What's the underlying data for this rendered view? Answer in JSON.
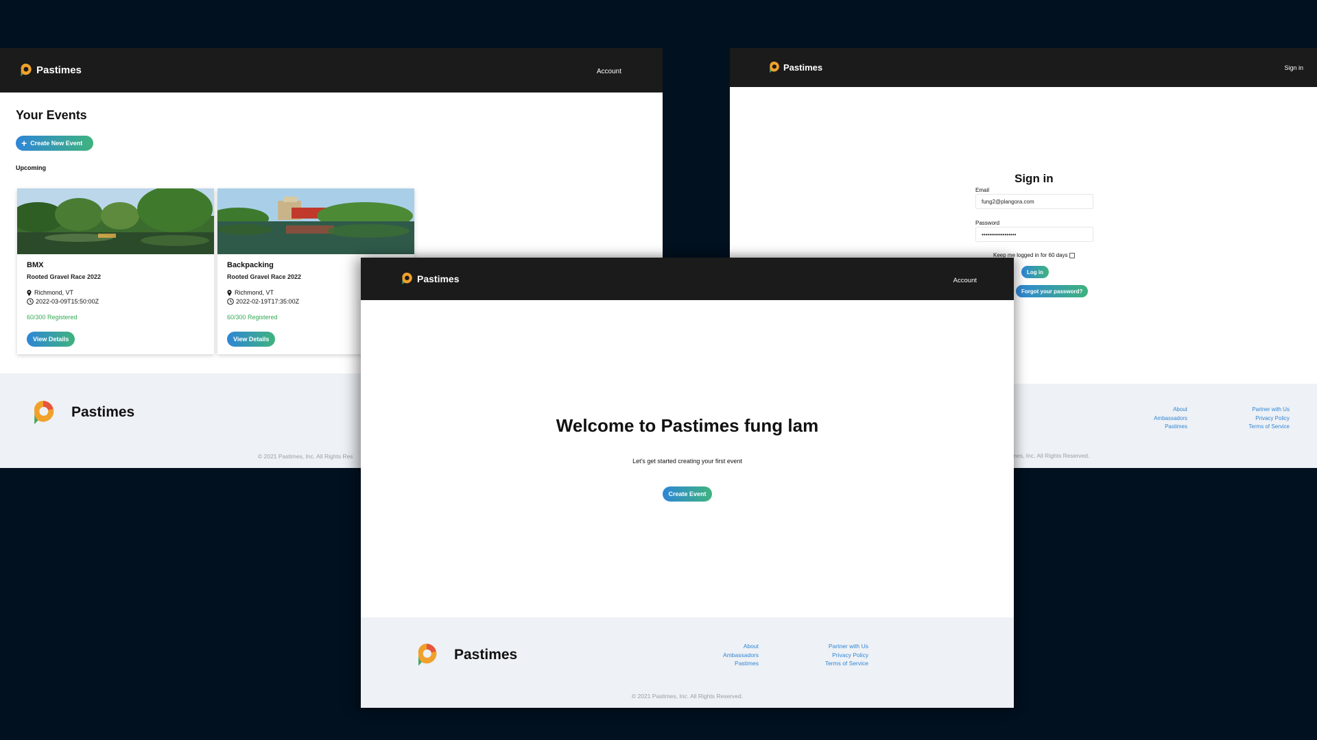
{
  "brand": {
    "name": "Pastimes"
  },
  "colors": {
    "background": "#021120",
    "nav": "#1b1b1b",
    "accent_start": "#2f86d6",
    "accent_end": "#3fb37e",
    "registered": "#34a853",
    "link": "#2f86d6"
  },
  "events_window": {
    "nav_account": "Account",
    "title": "Your Events",
    "create_button": "Create New Event",
    "section": "Upcoming",
    "cards": [
      {
        "title": "BMX",
        "subtitle": "Rooted Gravel Race 2022",
        "location": "Richmond, VT",
        "datetime": "2022-03-09T15:50:00Z",
        "registered": "60/300 Registered",
        "button": "View Details"
      },
      {
        "title": "Backpacking",
        "subtitle": "Rooted Gravel Race 2022",
        "location": "Richmond, VT",
        "datetime": "2022-02-19T17:35:00Z",
        "registered": "60/300 Registered",
        "button": "View Details"
      }
    ],
    "copyright_partial": "© 2021 Pastimes, Inc. All Rights Res"
  },
  "signin_window": {
    "nav_signin": "Sign in",
    "title": "Sign in",
    "email_label": "Email",
    "email_value": "fung2@plangora.com",
    "password_label": "Password",
    "password_value": "••••••••••••••••••",
    "keep_logged": "Keep me logged in for 60 days",
    "login_button": "Log in",
    "forgot_button": "Forgot your password?",
    "copyright_partial": "mes, Inc. All Rights Reserved."
  },
  "welcome_window": {
    "nav_account": "Account",
    "title": "Welcome to Pastimes fung lam",
    "subtitle": "Let's get started creating your first event",
    "create_button": "Create Event",
    "copyright": "© 2021 Pastimes, Inc. All Rights Reserved."
  },
  "footer": {
    "col1": [
      "About",
      "Ambassadors",
      "Pastimes"
    ],
    "col2": [
      "Partner with Us",
      "Privacy Policy",
      "Terms of Service"
    ]
  },
  "icons": [
    "pastimes-logo",
    "plus-icon",
    "map-pin-icon",
    "clock-icon",
    "checkbox"
  ]
}
